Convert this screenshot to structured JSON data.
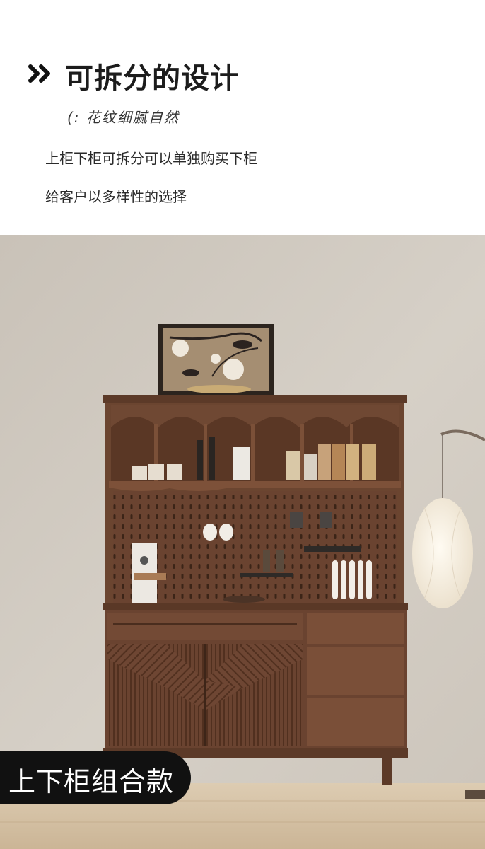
{
  "header": {
    "title": "可拆分的设计",
    "subtitle": "(: 花纹细腻自然",
    "line1": "上柜下柜可拆分可以单独购买下柜",
    "line2": "给客户以多样性的选择"
  },
  "badge": {
    "label": "上下柜组合款"
  },
  "icons": {
    "title_bullet": "double-chevron-right-icon"
  },
  "colors": {
    "wall": "#cfc8be",
    "floor": "#d9c6aa",
    "wood": "#6b4632",
    "badge_bg": "#111111"
  }
}
